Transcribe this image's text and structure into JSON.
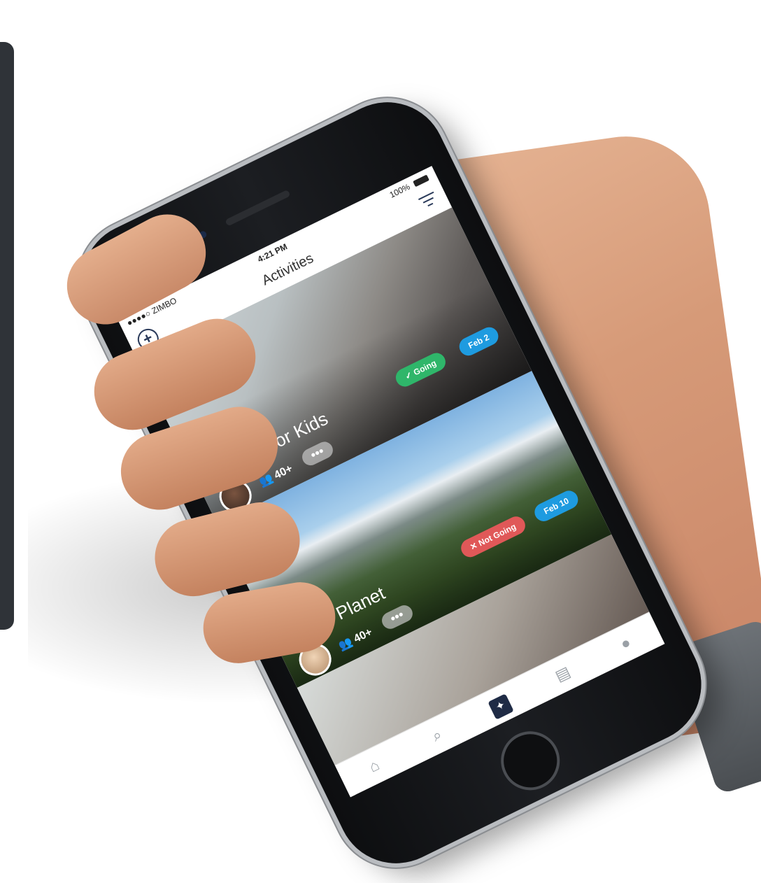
{
  "status": {
    "carrier": "●●●●○ ZIMBO",
    "time": "4:21 PM",
    "battery": "100%"
  },
  "nav": {
    "title": "Activities",
    "add_icon": "plus-circle-icon",
    "filter_icon": "filter-icon"
  },
  "activities": [
    {
      "title": "Glasses for Kids",
      "rsvp": "✓ Going",
      "date": "Feb 2",
      "attendees": "40+",
      "more": "•••"
    },
    {
      "title": "Green Planet",
      "rsvp": "✕ Not Going",
      "date": "Feb 10",
      "attendees": "40+",
      "more": "•••"
    }
  ],
  "tabs": [
    {
      "name": "home",
      "icon": "home-icon",
      "glyph": "⌂"
    },
    {
      "name": "search",
      "icon": "search-icon",
      "glyph": "⌕"
    },
    {
      "name": "activities",
      "icon": "star-badge-icon",
      "glyph": "✦"
    },
    {
      "name": "messages",
      "icon": "chat-icon",
      "glyph": "▤"
    },
    {
      "name": "profile",
      "icon": "person-icon",
      "glyph": "●"
    }
  ],
  "colors": {
    "going": "#2fb66a",
    "not_going": "#e05858",
    "date": "#1e9be0",
    "accent": "#1f2b45"
  }
}
